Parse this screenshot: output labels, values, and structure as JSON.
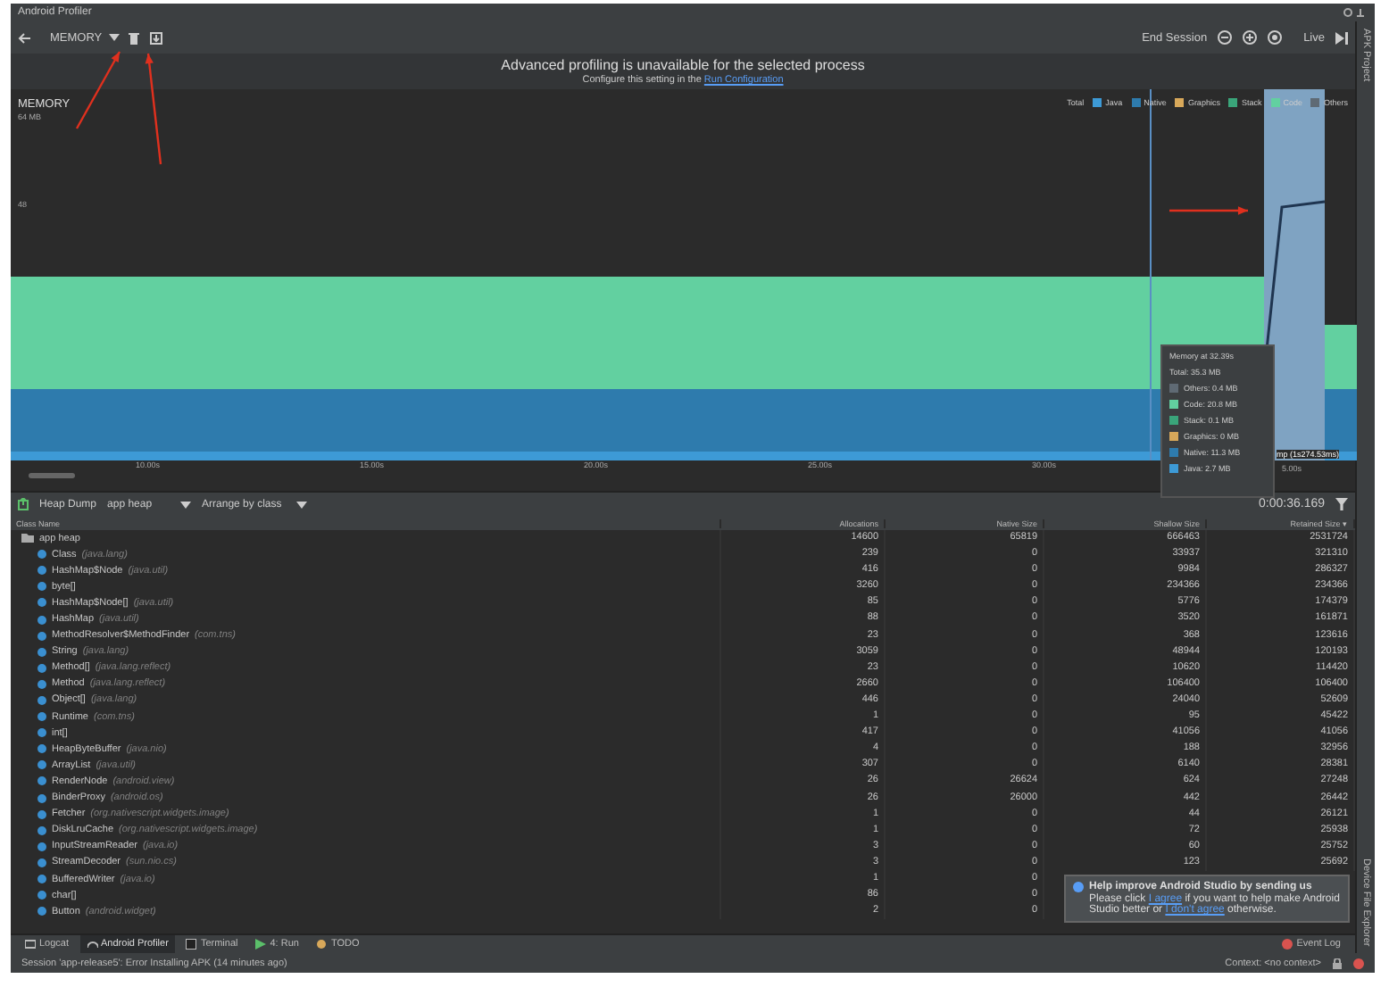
{
  "window": {
    "title": "Android Profiler"
  },
  "toolbar": {
    "profiler": "MEMORY",
    "end_session": "End Session",
    "live": "Live"
  },
  "banner": {
    "title": "Advanced profiling is unavailable for the selected process",
    "text": "Configure this setting in the ",
    "link": "Run Configuration"
  },
  "memory_chart": {
    "title": "MEMORY",
    "axis_top": "64 MB",
    "axis_mid": "48",
    "legend": [
      {
        "label": "Total"
      },
      {
        "label": "Java",
        "color": "#3d9ad6"
      },
      {
        "label": "Native",
        "color": "#2e7bad"
      },
      {
        "label": "Graphics",
        "color": "#d8a85a"
      },
      {
        "label": "Stack",
        "color": "#3aa57a"
      },
      {
        "label": "Code",
        "color": "#62d0a0"
      },
      {
        "label": "Others",
        "color": "#5f6a74"
      }
    ],
    "time_labels": [
      "10.00s",
      "15.00s",
      "20.00s",
      "25.00s",
      "30.00s"
    ],
    "heap_dump_label": "mp (1s274.53ms)",
    "end_label": "5.00s",
    "tooltip": {
      "title": "Memory at 32.39s",
      "total": "Total: 35.3 MB",
      "items": [
        {
          "label": "Others: 0.4 MB",
          "color": "#5f6a74"
        },
        {
          "label": "Code: 20.8 MB",
          "color": "#62d0a0"
        },
        {
          "label": "Stack: 0.1 MB",
          "color": "#3aa57a"
        },
        {
          "label": "Graphics: 0 MB",
          "color": "#d8a85a"
        },
        {
          "label": "Native: 11.3 MB",
          "color": "#2e7bad"
        },
        {
          "label": "Java: 2.7 MB",
          "color": "#3d9ad6"
        }
      ]
    }
  },
  "heap_bar": {
    "label": "Heap Dump",
    "heap": "app heap",
    "arrange": "Arrange by class",
    "time": "0:00:36.169"
  },
  "table": {
    "columns": [
      "Class Name",
      "Allocations",
      "Native Size",
      "Shallow Size",
      "Retained Size ▾"
    ],
    "rows": [
      {
        "kind": "heap",
        "cells": [
          {
            "name": "app heap"
          },
          "14600",
          "65819",
          "666463",
          "2531724"
        ]
      },
      {
        "kind": "class",
        "cells": [
          {
            "name": "Class",
            "package": "(java.lang)"
          },
          "239",
          "0",
          "33937",
          "321310"
        ]
      },
      {
        "kind": "class",
        "cells": [
          {
            "name": "HashMap$Node",
            "package": "(java.util)"
          },
          "416",
          "0",
          "9984",
          "286327"
        ]
      },
      {
        "kind": "class",
        "cells": [
          {
            "name": "byte[]"
          },
          "3260",
          "0",
          "234366",
          "234366"
        ]
      },
      {
        "kind": "class",
        "cells": [
          {
            "name": "HashMap$Node[]",
            "package": "(java.util)"
          },
          "85",
          "0",
          "5776",
          "174379"
        ]
      },
      {
        "kind": "class",
        "cells": [
          {
            "name": "HashMap",
            "package": "(java.util)"
          },
          "88",
          "0",
          "3520",
          "161871"
        ]
      },
      {
        "kind": "class",
        "cells": [
          {
            "name": "MethodResolver$MethodFinder",
            "package": "(com.tns)"
          },
          "23",
          "0",
          "368",
          "123616"
        ]
      },
      {
        "kind": "class",
        "cells": [
          {
            "name": "String",
            "package": "(java.lang)"
          },
          "3059",
          "0",
          "48944",
          "120193"
        ]
      },
      {
        "kind": "class",
        "cells": [
          {
            "name": "Method[]",
            "package": "(java.lang.reflect)"
          },
          "23",
          "0",
          "10620",
          "114420"
        ]
      },
      {
        "kind": "class",
        "cells": [
          {
            "name": "Method",
            "package": "(java.lang.reflect)"
          },
          "2660",
          "0",
          "106400",
          "106400"
        ]
      },
      {
        "kind": "class",
        "cells": [
          {
            "name": "Object[]",
            "package": "(java.lang)"
          },
          "446",
          "0",
          "24040",
          "52609"
        ]
      },
      {
        "kind": "class",
        "cells": [
          {
            "name": "Runtime",
            "package": "(com.tns)"
          },
          "1",
          "0",
          "95",
          "45422"
        ]
      },
      {
        "kind": "class",
        "cells": [
          {
            "name": "int[]"
          },
          "417",
          "0",
          "41056",
          "41056"
        ]
      },
      {
        "kind": "class",
        "cells": [
          {
            "name": "HeapByteBuffer",
            "package": "(java.nio)"
          },
          "4",
          "0",
          "188",
          "32956"
        ]
      },
      {
        "kind": "class",
        "cells": [
          {
            "name": "ArrayList",
            "package": "(java.util)"
          },
          "307",
          "0",
          "6140",
          "28381"
        ]
      },
      {
        "kind": "class",
        "cells": [
          {
            "name": "RenderNode",
            "package": "(android.view)"
          },
          "26",
          "26624",
          "624",
          "27248"
        ]
      },
      {
        "kind": "class",
        "cells": [
          {
            "name": "BinderProxy",
            "package": "(android.os)"
          },
          "26",
          "26000",
          "442",
          "26442"
        ]
      },
      {
        "kind": "class",
        "cells": [
          {
            "name": "Fetcher",
            "package": "(org.nativescript.widgets.image)"
          },
          "1",
          "0",
          "44",
          "26121"
        ]
      },
      {
        "kind": "class",
        "cells": [
          {
            "name": "DiskLruCache",
            "package": "(org.nativescript.widgets.image)"
          },
          "1",
          "0",
          "72",
          "25938"
        ]
      },
      {
        "kind": "class",
        "cells": [
          {
            "name": "InputStreamReader",
            "package": "(java.io)"
          },
          "3",
          "0",
          "60",
          "25752"
        ]
      },
      {
        "kind": "class",
        "cells": [
          {
            "name": "StreamDecoder",
            "package": "(sun.nio.cs)"
          },
          "3",
          "0",
          "123",
          "25692"
        ]
      },
      {
        "kind": "class",
        "cells": [
          {
            "name": "BufferedWriter",
            "package": "(java.io)"
          },
          "1",
          "0"
        ]
      },
      {
        "kind": "class",
        "cells": [
          {
            "name": "char[]"
          },
          "86",
          "0"
        ]
      },
      {
        "kind": "class",
        "cells": [
          {
            "name": "Button",
            "package": "(android.widget)"
          },
          "2",
          "0"
        ]
      }
    ]
  },
  "notification": {
    "title": "Help improve Android Studio by sending us",
    "text_before": "Please click ",
    "agree": "I agree",
    "text_middle": " if you want to help make Android Studio better or ",
    "disagree": "I don't agree",
    "text_after": " otherwise."
  },
  "tool_windows": [
    {
      "label": "Logcat",
      "selected": false
    },
    {
      "label": "Android Profiler",
      "selected": true
    },
    {
      "label": "Terminal",
      "selected": false
    },
    {
      "label": "4: Run",
      "selected": false
    },
    {
      "label": "TODO",
      "selected": false
    }
  ],
  "event_log": "Event Log",
  "side_tabs": {
    "top": "APK Project",
    "bottom": "Device File Explorer"
  },
  "status_bar": {
    "message": "Session 'app-release5': Error Installing APK (14 minutes ago)",
    "context": "Context: <no context>"
  }
}
